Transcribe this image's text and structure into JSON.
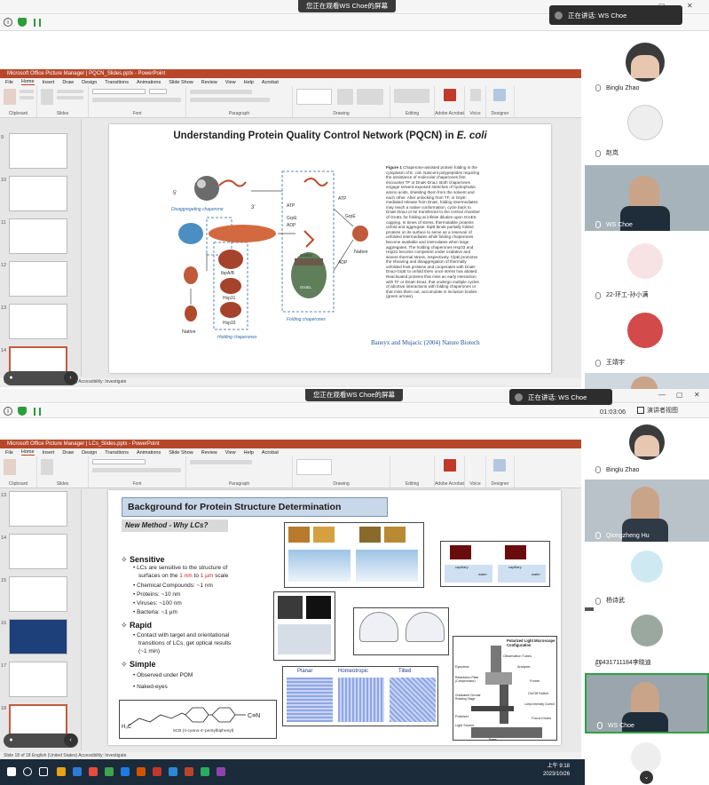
{
  "top": {
    "share_banner": "您正在观看WS Choe的屏幕",
    "speaking": "正在讲话: WS Choe",
    "ppt_title": "Microsoft Office Picture Manager  |  PQCN_Slides.pptx  -  PowerPoint",
    "menu": [
      "File",
      "Home",
      "Insert",
      "Draw",
      "Design",
      "Transitions",
      "Animations",
      "Slide Show",
      "Review",
      "View",
      "Help",
      "Acrobat"
    ],
    "ribbon_groups": [
      "Clipboard",
      "Slides",
      "Font",
      "Paragraph",
      "Drawing",
      "Editing",
      "Adobe Acrobat",
      "Voice",
      "Designer"
    ],
    "thumb_numbers": [
      "9",
      "10",
      "11",
      "12",
      "13",
      "14"
    ],
    "slide": {
      "title_main": "Understanding Protein Quality Control Network (PQCN) in ",
      "title_italic": "E. coli",
      "citation": "Baneyx and Mujacic (2004) Nature Biotech",
      "caption_title": "Figure 1",
      "caption": "Chaperone-assisted protein folding in the cytoplasm of E. coli. Nascent polypeptides requiring the assistance of molecular chaperones first encounter TF or DnaK-DnaJ. Both chaperones engage solvent-exposed stretches of hydrophobic amino acids, shielding them from the solvent and each other. After unlocking from TF, or GrpE-mediated release from DnaK, folding intermediates may reach a native conformation, cycle back to DnaK-DnaJ or be transferred to the central chamber of GroEL for folding at infinite dilution upon GroES capping. In times of stress, thermolabile proteins unfold and aggregate. IbpB binds partially folded proteins on its surface to serve as a reservoir of unfolded intermediates while folding chaperones become available and intercalates when large aggregates. The holding chaperones Hsp33 and Hsp31 become competent under oxidative and severe thermal stress, respectively. ClpB promotes the shearing and disaggregation of thermally unfolded host proteins and cooperates with DnaK-DnaJ-GrpE to unfold them once stress has abated. Reactivated proteins that miss an early interaction with TF or DnaK-DnaJ, that undergo multiple cycles of abortive interactions with folding chaperones or that miss them out, accumulate in inclusion bodies (green arrows).",
      "labels": {
        "disaggregating": "Disaggregating chaperone",
        "folding": "Folding chaperones",
        "holding": "Holding chaperones",
        "native": "Native",
        "ibpab": "IbpA/B",
        "hsp31": "Hsp31",
        "hsp33": "Hsp33",
        "groel": "GroEL",
        "groes": "GroES",
        "atp": "ATP",
        "adp": "ADP",
        "grpe": "GrpE",
        "five_prime": "5'",
        "three_prime": "3'"
      }
    },
    "status": "Slide 14 of 18   English (United States)   Accessibility: Investigate"
  },
  "bottom": {
    "share_banner": "您正在观看WS Choe的屏幕",
    "speaking": "正在讲话: WS Choe",
    "timer": "01:03:06",
    "view_btn": "演讲者视图",
    "ppt_title": "Microsoft Office Picture Manager  |  LCs_Slides.pptx  -  PowerPoint",
    "menu": [
      "File",
      "Home",
      "Insert",
      "Draw",
      "Design",
      "Transitions",
      "Animations",
      "Slide Show",
      "Review",
      "View",
      "Help",
      "Acrobat"
    ],
    "thumb_numbers": [
      "13",
      "14",
      "15",
      "16",
      "17",
      "18"
    ],
    "slide": {
      "title": "Background for Protein Structure Determination",
      "subtitle": "New Method - Why LCs?",
      "sensitive": "Sensitive",
      "b1a": "LCs are sensitive to the structure of",
      "b1b_pre": "surfaces on the ",
      "b1b_r1": "1 nm",
      "b1b_mid": " to ",
      "b1b_r2": "1 µm",
      "b1b_post": " scale",
      "b2": "Chemical Compounds: ~1 nm",
      "b3": "Proteins: ~10 nm",
      "b4": "Viruses: ~100 nm",
      "b5": "Bacteria: ~1 µm",
      "rapid": "Rapid",
      "b6a": "Contact with target and orientational",
      "b6b": "transitions of LCs, get optical results",
      "b6c": "(~1 min)",
      "simple": "Simple",
      "b7": "Observed under POM",
      "b8": "Naked-eyes",
      "molecule_label": "5CB (4-cyano-4'-pentylbiphenyl)",
      "planar": "Planar",
      "homeotropic": "Homeotropic",
      "tilted": "Tilted",
      "polarized": "Polarized Light Microscope Configuration",
      "capillary": "capillary",
      "water": "water",
      "microscope_labels": [
        "Observation Tubes",
        "Analyzer",
        "Eyepiece",
        "Retardation Plate (Compensator)",
        "Frame",
        "Graduated Circular Rotating Stage",
        "On/Off Switch",
        "Polarizer",
        "Lamp Intensity Control",
        "Light Source",
        "Focus Knobs",
        "Base"
      ]
    },
    "status": "Slide 18 of 18   English (United States)   Accessibility: Investigate"
  },
  "participants_top": [
    {
      "name": "王正在讲话: WS Choe"
    },
    {
      "name": "Binglu Zhao"
    },
    {
      "name": "赵岚"
    },
    {
      "name": "WS Choe"
    },
    {
      "name": "22-环工-孙小满"
    },
    {
      "name": "王靖宇"
    }
  ],
  "participants_bottom": [
    {
      "name": "Binglu Zhao"
    },
    {
      "name": "Qiongzheng Hu"
    },
    {
      "name": "杨诗武"
    },
    {
      "name": "10431711184李晓迪"
    },
    {
      "name": "WS Choe"
    }
  ],
  "taskbar": {
    "time": "上午 9:18",
    "date": "2023/10/26"
  }
}
